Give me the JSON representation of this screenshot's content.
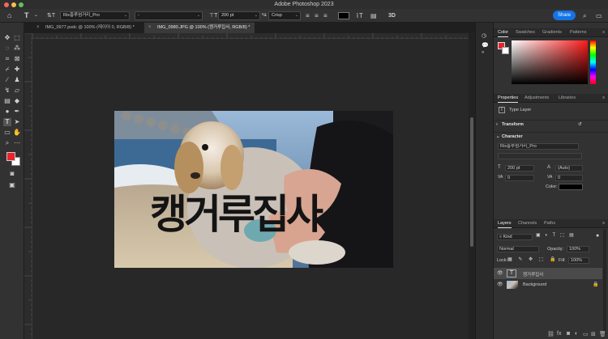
{
  "app": {
    "title": "Adobe Photoshop 2023"
  },
  "colors": {
    "accent": "#1473e6",
    "foreground": "#e8232a",
    "background": "#ffffff",
    "text_color": "#000000"
  },
  "options_bar": {
    "font_family": "Rix홍루섬거리_Pro",
    "font_style": "-",
    "font_size": "200 pt",
    "antialias": "Crisp",
    "share_label": "Share"
  },
  "tabs": [
    {
      "label": "IMG_0977.psdc @ 100% (레이어 0, RGB/8) *",
      "active": false
    },
    {
      "label": "IMG_0980.JPG @ 100% (캥거루집사, RGB/8) *",
      "active": true
    }
  ],
  "canvas": {
    "text_layer_content": "캥거루집사"
  },
  "panels": {
    "color_tabs": [
      "Color",
      "Swatches",
      "Gradients",
      "Patterns"
    ],
    "properties_tabs": [
      "Properties",
      "Adjustments",
      "Libraries"
    ],
    "properties": {
      "layer_type": "Type Layer",
      "transform_label": "Transform",
      "character_label": "Character",
      "font_family": "Rix홍루섬거리_Pro",
      "font_size": "200 pt",
      "leading": "(Auto)",
      "kerning": "0",
      "tracking": "0",
      "color_label": "Color:"
    },
    "layers_tabs": [
      "Layers",
      "Channels",
      "Paths"
    ],
    "layers": {
      "filter_kind": "Kind",
      "blend_mode": "Normal",
      "opacity_label": "Opacity:",
      "opacity_value": "100%",
      "lock_label": "Lock:",
      "fill_label": "Fill:",
      "fill_value": "100%",
      "items": [
        {
          "name": "캥거루집사",
          "type": "text",
          "selected": true
        },
        {
          "name": "Background",
          "type": "image",
          "selected": false
        }
      ]
    }
  }
}
